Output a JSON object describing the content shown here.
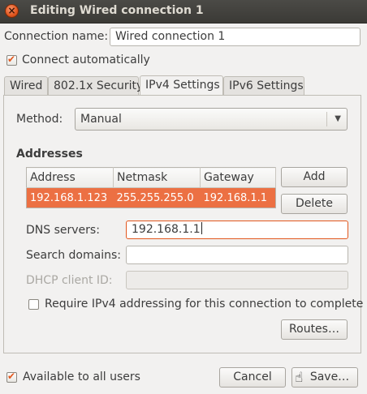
{
  "window": {
    "title": "Editing Wired connection 1"
  },
  "connection_name": {
    "label": "Connection name:",
    "value": "Wired connection 1"
  },
  "connect_automatically": {
    "label": "Connect automatically",
    "checked": true
  },
  "tabs": [
    {
      "label": "Wired",
      "active": false
    },
    {
      "label": "802.1x Security",
      "active": false
    },
    {
      "label": "IPv4 Settings",
      "active": true
    },
    {
      "label": "IPv6 Settings",
      "active": false
    }
  ],
  "method": {
    "label": "Method:",
    "value": "Manual"
  },
  "addresses": {
    "heading": "Addresses",
    "columns": [
      "Address",
      "Netmask",
      "Gateway"
    ],
    "rows": [
      [
        "192.168.1.123",
        "255.255.255.0",
        "192.168.1.1"
      ]
    ],
    "add_label": "Add",
    "delete_label": "Delete"
  },
  "dns": {
    "label": "DNS servers:",
    "value": "192.168.1.1"
  },
  "search_domains": {
    "label": "Search domains:",
    "value": ""
  },
  "dhcp_client_id": {
    "label": "DHCP client ID:",
    "value": ""
  },
  "require_ipv4": {
    "label": "Require IPv4 addressing for this connection to complete",
    "checked": false
  },
  "routes_label": "Routes…",
  "available_all_users": {
    "label": "Available to all users",
    "checked": true
  },
  "cancel_label": "Cancel",
  "save_label": "Save…",
  "colors": {
    "accent": "#ec7043",
    "titlebar": "#3c3b37"
  }
}
